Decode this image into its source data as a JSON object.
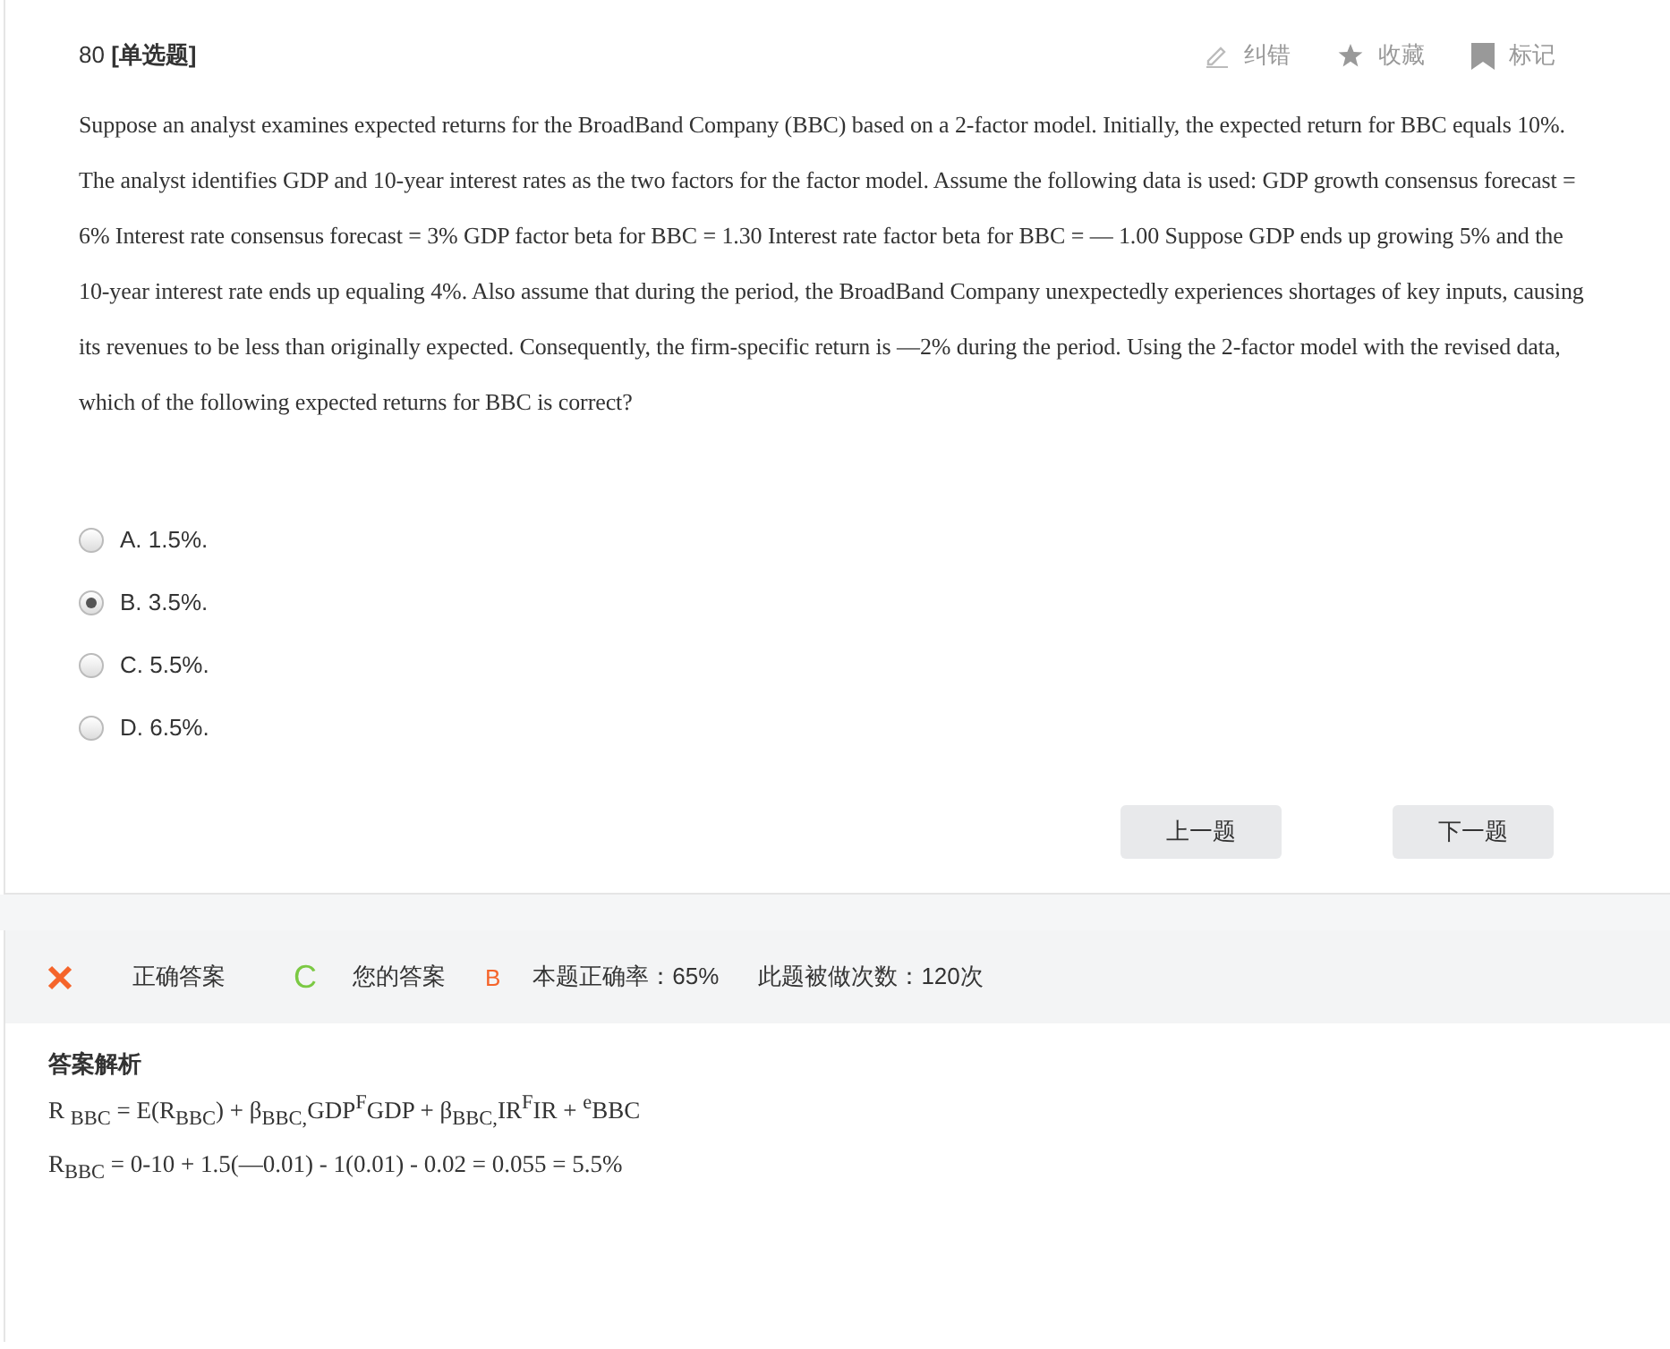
{
  "question": {
    "number": "80",
    "type": "[单选题]",
    "actions": [
      {
        "kind": "edit",
        "label": "纠错"
      },
      {
        "kind": "star",
        "label": "收藏"
      },
      {
        "kind": "flag",
        "label": "标记"
      }
    ],
    "text": "Suppose an analyst examines expected returns for the BroadBand Company (BBC) based on a 2-factor model. Initially, the expected return for BBC equals 10%. The analyst identifies GDP and 10-year interest rates as the two factors for the factor model. Assume the following data is used: GDP growth consensus forecast = 6% Interest rate consensus forecast  = 3% GDP factor beta for BBC  = 1.30 Interest rate factor beta for BBC = — 1.00 Suppose GDP ends up growing 5% and the 10-year interest rate ends up equaling 4%. Also assume that during the period, the BroadBand Company unexpectedly experiences shortages of key inputs, causing its revenues to be less than originally expected. Consequently, the firm-specific return is —2% during the period. Using the 2-factor model with the revised data, which of the following expected returns for BBC is correct?",
    "options": [
      {
        "label": "A. 1.5%.",
        "selected": false
      },
      {
        "label": "B. 3.5%.",
        "selected": true
      },
      {
        "label": "C. 5.5%.",
        "selected": false
      },
      {
        "label": "D. 6.5%.",
        "selected": false
      }
    ],
    "buttons": [
      "上一题",
      "下一题"
    ]
  },
  "result": {
    "correct": false,
    "correct_label": "正确答案",
    "correct_answer": "C",
    "your_label": "您的答案",
    "your_answer": "B",
    "accuracy": "本题正确率：65%",
    "attempts": "此题被做次数：120次"
  },
  "explanation": {
    "title": "答案解析",
    "lines": [
      "R $_{BBC}$ = E(R$_{BBC}$)  + β$_{BBC,}$GDP$^{F}$GDP + β$_{BBC,}$IR$^{F}$IR + $^{e}$BBC",
      "R$_{BBC}$ = 0-10 + 1.5(—0.01) - 1(0.01) - 0.02 = 0.055 = 5.5%"
    ]
  }
}
